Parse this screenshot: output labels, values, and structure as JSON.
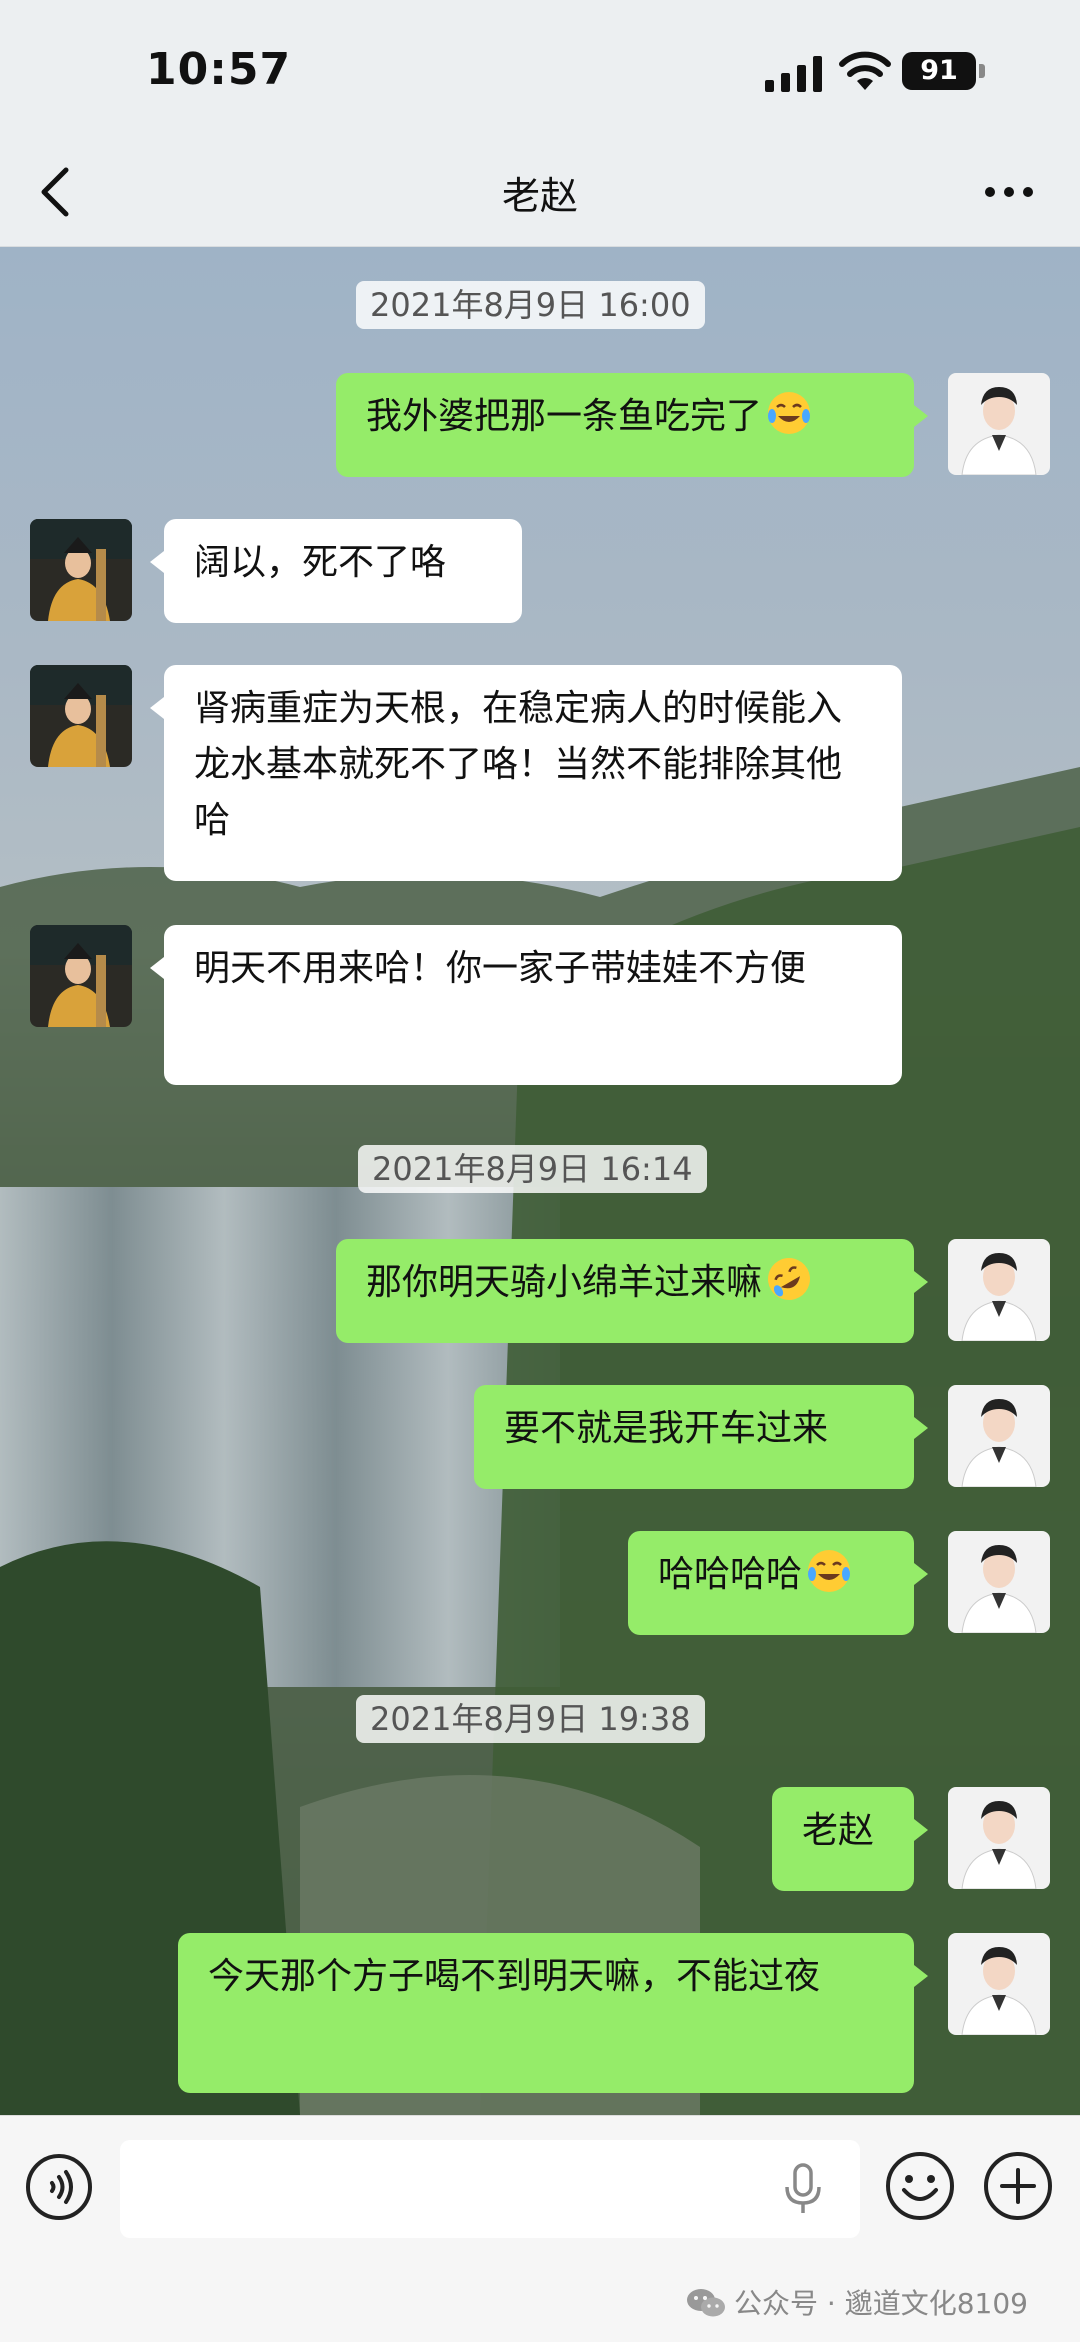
{
  "status_bar": {
    "time": "10:57",
    "battery": "91"
  },
  "nav": {
    "title": "老赵"
  },
  "messages": [
    {
      "type": "timestamp",
      "text": "2021年8月9日 16:00"
    },
    {
      "type": "sent",
      "text": "我外婆把那一条鱼吃完了",
      "emoji": "joy-tears-emoji"
    },
    {
      "type": "received",
      "text": "阔以，死不了咯"
    },
    {
      "type": "received",
      "text": "肾病重症为天根，在稳定病人的时候能入龙水基本就死不了咯！当然不能排除其他哈"
    },
    {
      "type": "received",
      "text": "明天不用来哈！你一家子带娃娃不方便"
    },
    {
      "type": "timestamp",
      "text": "2021年8月9日 16:14"
    },
    {
      "type": "sent",
      "text": "那你明天骑小绵羊过来嘛",
      "emoji": "rolling-laugh-emoji"
    },
    {
      "type": "sent",
      "text": "要不就是我开车过来"
    },
    {
      "type": "sent",
      "text": "哈哈哈哈",
      "emoji": "joy-tears-emoji"
    },
    {
      "type": "timestamp",
      "text": "2021年8月9日 19:38"
    },
    {
      "type": "sent",
      "text": "老赵"
    },
    {
      "type": "sent",
      "text": "今天那个方子喝不到明天嘛，不能过夜"
    }
  ],
  "input": {
    "placeholder": ""
  },
  "watermark": "公众号 · 邈道文化8109",
  "colors": {
    "sent_bubble": "#95ec69",
    "received_bubble": "#ffffff"
  }
}
